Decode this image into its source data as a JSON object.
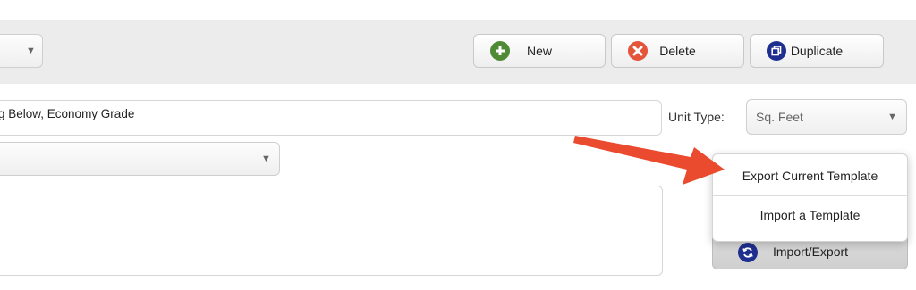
{
  "toolbar": {
    "new_label": "New",
    "delete_label": "Delete",
    "duplicate_label": "Duplicate",
    "new_icon": "plus-circle-icon",
    "delete_icon": "x-circle-icon",
    "duplicate_icon": "copy-icon",
    "colors": {
      "new": "#4f8a34",
      "delete": "#e4553a",
      "duplicate": "#1f2f8f"
    }
  },
  "form": {
    "name_value": "g Below, Economy Grade",
    "unit_type_label": "Unit Type:",
    "unit_type_value": "Sq. Feet"
  },
  "export_menu": {
    "items": [
      "Export Current Template",
      "Import a Template"
    ]
  },
  "import_export": {
    "label": "Import/Export",
    "icon": "refresh-icon",
    "icon_color": "#1f2f8f"
  },
  "annotation": {
    "arrow_color": "#ea4a2e"
  }
}
